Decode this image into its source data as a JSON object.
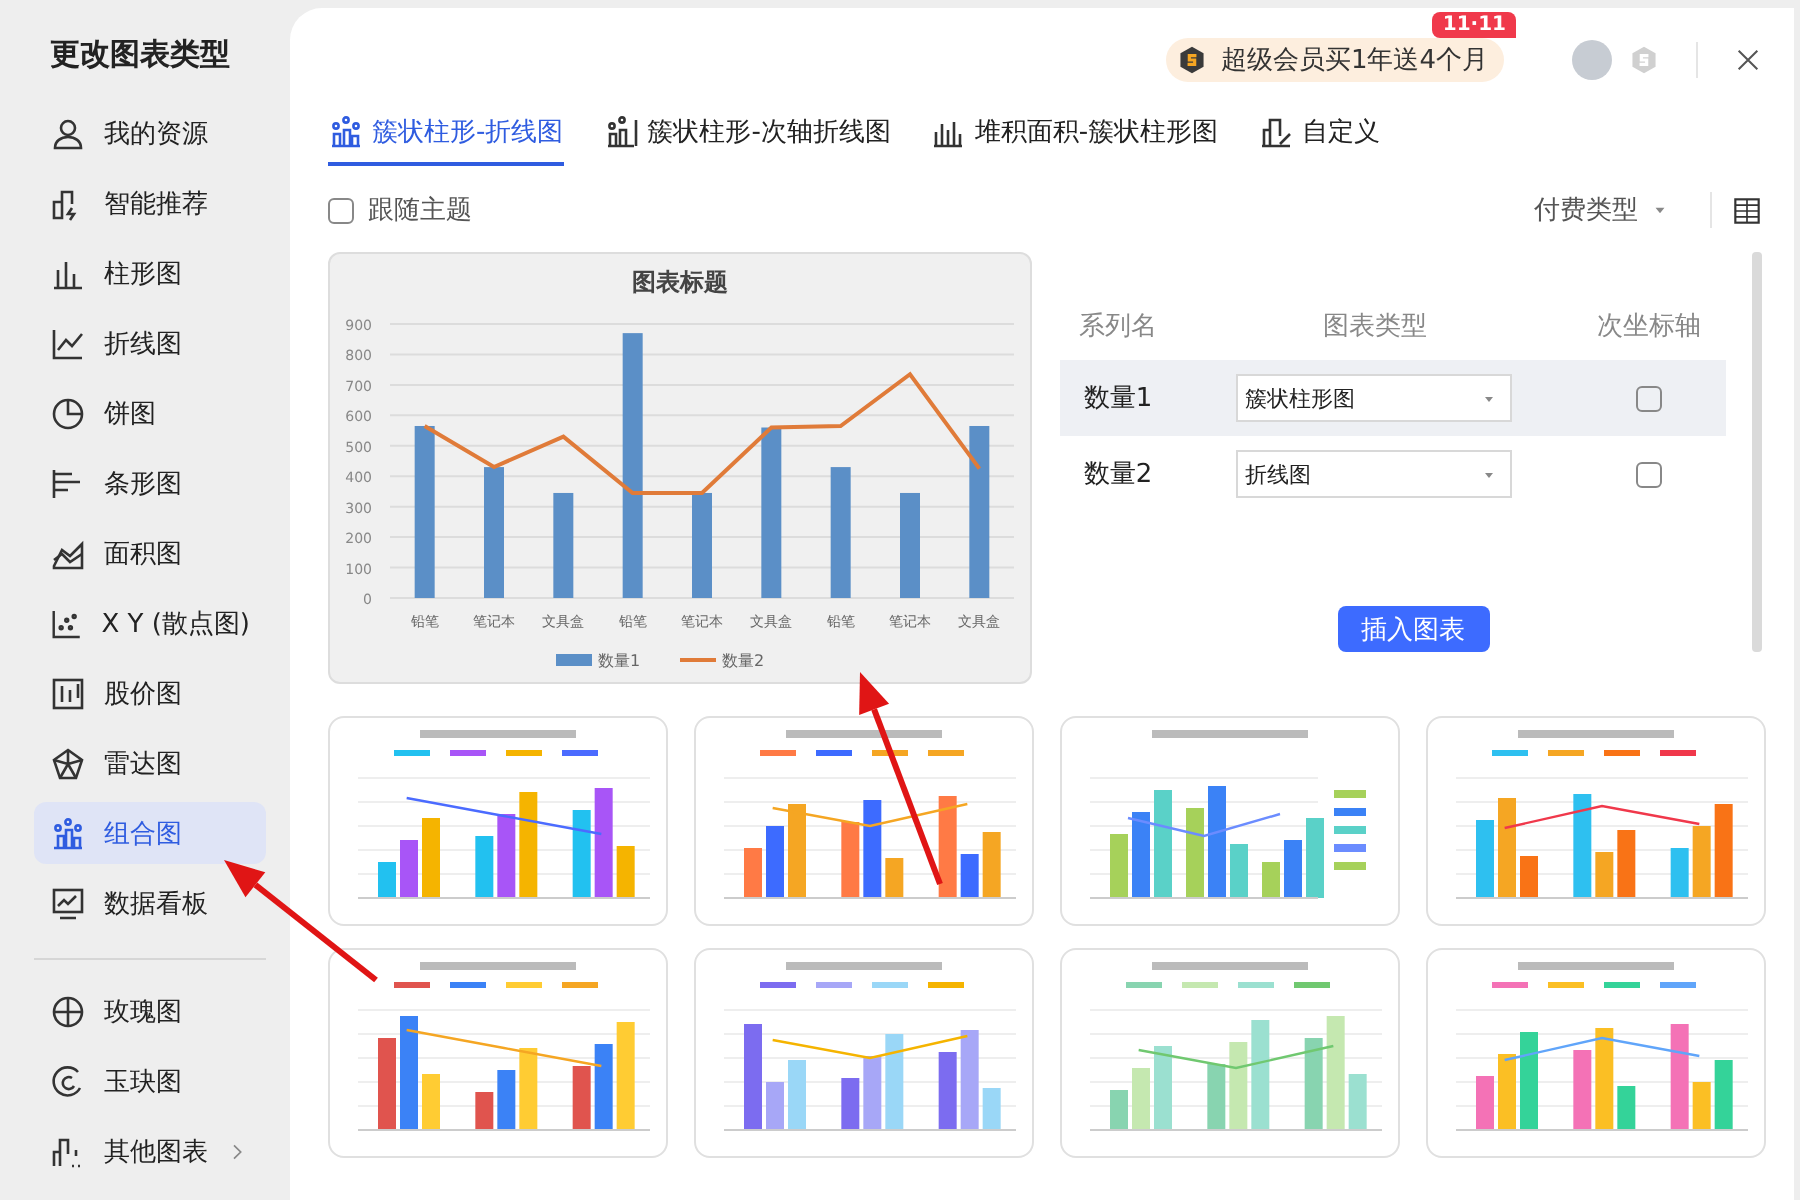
{
  "dialog": {
    "title": "更改图表类型"
  },
  "sidebar": {
    "groups": [
      [
        {
          "label": "我的资源",
          "selected": false,
          "has_submenu": false
        },
        {
          "label": "智能推荐",
          "selected": false,
          "has_submenu": false
        },
        {
          "label": "柱形图",
          "selected": false,
          "has_submenu": false
        },
        {
          "label": "折线图",
          "selected": false,
          "has_submenu": false
        },
        {
          "label": "饼图",
          "selected": false,
          "has_submenu": false
        },
        {
          "label": "条形图",
          "selected": false,
          "has_submenu": false
        },
        {
          "label": "面积图",
          "selected": false,
          "has_submenu": false
        },
        {
          "label": "X Y (散点图)",
          "selected": false,
          "has_submenu": false
        },
        {
          "label": "股价图",
          "selected": false,
          "has_submenu": false
        },
        {
          "label": "雷达图",
          "selected": false,
          "has_submenu": false
        },
        {
          "label": "组合图",
          "selected": true,
          "has_submenu": false
        },
        {
          "label": "数据看板",
          "selected": false,
          "has_submenu": false
        }
      ],
      [
        {
          "label": "玫瑰图",
          "selected": false,
          "has_submenu": false
        },
        {
          "label": "玉玦图",
          "selected": false,
          "has_submenu": false
        },
        {
          "label": "其他图表",
          "selected": false,
          "has_submenu": true
        }
      ]
    ]
  },
  "header": {
    "promo": {
      "text": "超级会员买1年送4个月",
      "badge": "11·11"
    }
  },
  "tabs": [
    {
      "label": "簇状柱形-折线图",
      "selected": true
    },
    {
      "label": "簇状柱形-次轴折线图",
      "selected": false
    },
    {
      "label": "堆积面积-簇状柱形图",
      "selected": false
    },
    {
      "label": "自定义",
      "selected": false
    }
  ],
  "toolbar": {
    "follow_theme": {
      "label": "跟随主题",
      "checked": false
    },
    "filter": {
      "label": "付费类型"
    }
  },
  "preview": {
    "chart_data": {
      "type": "bar",
      "title": "图表标题",
      "categories": [
        "铅笔",
        "笔记本",
        "文具盒",
        "铅笔",
        "笔记本",
        "文具盒",
        "铅笔",
        "笔记本",
        "文具盒"
      ],
      "series": [
        {
          "name": "数量1",
          "color": "#5b8fc7",
          "values": [
            565,
            430,
            345,
            870,
            345,
            560,
            430,
            345,
            565
          ]
        },
        {
          "name": "数量2",
          "color": "#e07b39",
          "type": "line",
          "values": [
            565,
            430,
            530,
            345,
            345,
            560,
            565,
            735,
            425
          ]
        }
      ],
      "grid": true,
      "legend": true,
      "ylim": [
        0,
        900
      ],
      "yticks": [
        0,
        100,
        200,
        300,
        400,
        500,
        600,
        700,
        800,
        900
      ]
    }
  },
  "series_panel": {
    "columns": [
      "系列名",
      "图表类型",
      "次坐标轴"
    ],
    "rows": [
      {
        "name": "数量1",
        "chart_type": "簇状柱形图",
        "secondary_axis": false,
        "highlighted": true
      },
      {
        "name": "数量2",
        "chart_type": "折线图",
        "secondary_axis": false,
        "highlighted": false
      }
    ],
    "insert_button": "插入图表"
  },
  "templates": [
    {
      "kind": "bar-line"
    },
    {
      "kind": "bar-line"
    },
    {
      "kind": "bar-line-side-legend"
    },
    {
      "kind": "bar-line"
    },
    {
      "kind": "bar-line"
    },
    {
      "kind": "bar-line"
    },
    {
      "kind": "bar-line"
    },
    {
      "kind": "bar-line"
    }
  ],
  "annotation_arrows": [
    {
      "kind": "arrow"
    },
    {
      "kind": "arrow"
    }
  ]
}
